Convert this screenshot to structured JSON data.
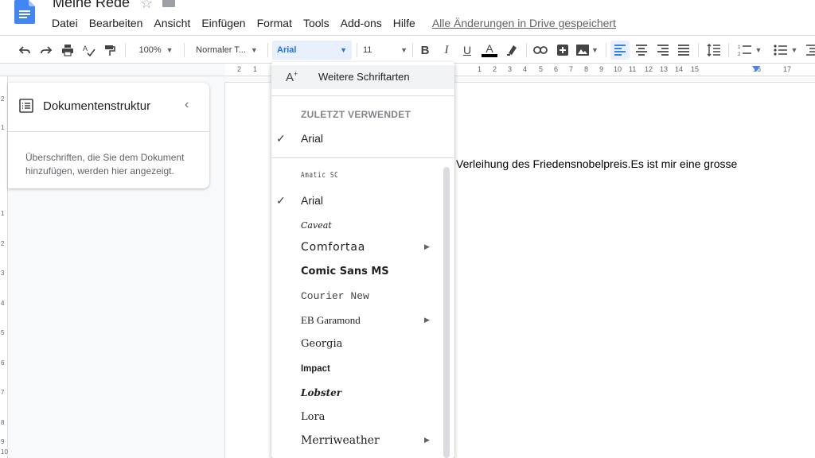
{
  "header": {
    "title": "Meine Rede",
    "menu": [
      "Datei",
      "Bearbeiten",
      "Ansicht",
      "Einfügen",
      "Format",
      "Tools",
      "Add-ons",
      "Hilfe"
    ],
    "saved_status": "Alle Änderungen in Drive gespeichert"
  },
  "toolbar": {
    "zoom": "100%",
    "style": "Normaler T...",
    "font": "Arial",
    "font_size": "11"
  },
  "ruler": {
    "numbers": [
      "2",
      "1",
      "1",
      "2",
      "3",
      "4",
      "5",
      "6",
      "7",
      "8",
      "9",
      "10",
      "11",
      "12",
      "13",
      "14",
      "15",
      "16",
      "17"
    ],
    "vertical_numbers": [
      "2",
      "1",
      "1",
      "2",
      "3",
      "4",
      "5",
      "6",
      "7",
      "8",
      "9",
      "10"
    ]
  },
  "outline": {
    "title": "Dokumentenstruktur",
    "hint": "Überschriften, die Sie dem Dokument hinzufügen, werden hier angezeigt."
  },
  "document": {
    "text": "Verleihung des Friedensnobelpreis.Es ist mir eine grosse"
  },
  "font_menu": {
    "more_fonts": "Weitere Schriftarten",
    "recent_header": "ZULETZT VERWENDET",
    "recent": [
      {
        "label": "Arial",
        "checked": true
      }
    ],
    "fonts": [
      {
        "label": "Amatic SC",
        "checked": false,
        "submenu": false
      },
      {
        "label": "Arial",
        "checked": true,
        "submenu": false
      },
      {
        "label": "Caveat",
        "checked": false,
        "submenu": false
      },
      {
        "label": "Comfortaa",
        "checked": false,
        "submenu": true
      },
      {
        "label": "Comic Sans MS",
        "checked": false,
        "submenu": false
      },
      {
        "label": "Courier New",
        "checked": false,
        "submenu": false
      },
      {
        "label": "EB Garamond",
        "checked": false,
        "submenu": true
      },
      {
        "label": "Georgia",
        "checked": false,
        "submenu": false
      },
      {
        "label": "Impact",
        "checked": false,
        "submenu": false
      },
      {
        "label": "Lobster",
        "checked": false,
        "submenu": false
      },
      {
        "label": "Lora",
        "checked": false,
        "submenu": false
      },
      {
        "label": "Merriweather",
        "checked": false,
        "submenu": true
      }
    ]
  },
  "colors": {
    "accent": "#1a73e8",
    "font_highlight": "#e8f0fe",
    "text_color_bar": "#000000"
  }
}
